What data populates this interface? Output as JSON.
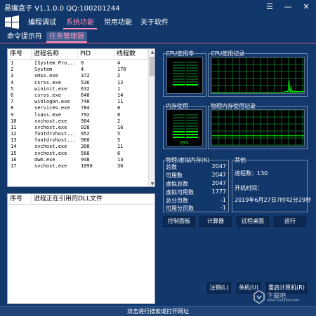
{
  "window": {
    "title": "易编盒子 V1.1.0.0 QQ:100201244",
    "controls": {
      "menu": "☰",
      "minimize": "—",
      "close": "✕"
    }
  },
  "topnav": {
    "items": [
      {
        "label": "编程调试",
        "active": false
      },
      {
        "label": "系统功能",
        "active": true
      },
      {
        "label": "常用功能",
        "active": false
      },
      {
        "label": "关于软件",
        "active": false
      }
    ]
  },
  "subtabs": {
    "items": [
      {
        "label": "命令提示符",
        "active": false
      },
      {
        "label": "任务管理器",
        "active": true
      }
    ]
  },
  "process_table": {
    "columns": [
      "序号",
      "进程名称",
      "PID",
      "线程数"
    ],
    "rows": [
      [
        "1",
        "[System Pro...",
        "0",
        "4"
      ],
      [
        "2",
        "System",
        "4",
        "170"
      ],
      [
        "3",
        "smss.exe",
        "372",
        "2"
      ],
      [
        "4",
        "csrss.exe",
        "536",
        "12"
      ],
      [
        "5",
        "wininit.exe",
        "632",
        "1"
      ],
      [
        "6",
        "csrss.exe",
        "640",
        "14"
      ],
      [
        "7",
        "winlogon.exe",
        "740",
        "11"
      ],
      [
        "8",
        "services.exe",
        "784",
        "8"
      ],
      [
        "9",
        "lsass.exe",
        "792",
        "8"
      ],
      [
        "10",
        "svchost.exe",
        "904",
        "2"
      ],
      [
        "11",
        "svchost.exe",
        "928",
        "16"
      ],
      [
        "12",
        "fontdrvhost...",
        "952",
        "5"
      ],
      [
        "13",
        "fontdrvhost...",
        "960",
        "5"
      ],
      [
        "14",
        "svchost.exe",
        "308",
        "11"
      ],
      [
        "15",
        "svchost.exe",
        "568",
        "6"
      ],
      [
        "16",
        "dwm.exe",
        "948",
        "13"
      ],
      [
        "17",
        "svchost.exe",
        "1096",
        "36"
      ]
    ]
  },
  "dll_table": {
    "columns": [
      "序号",
      "进程正在引用的DLL文件"
    ]
  },
  "monitors": {
    "cpu_usage_label": "CPU使用率",
    "cpu_history_label": "CPU使用记录",
    "mem_usage_label": "内存使用",
    "mem_history_label": "物理内存使用记录",
    "mem_percent_text": "29%",
    "cpu_percent": 0.06,
    "mem_percent": 0.29,
    "cpu_history": [
      0,
      0,
      0,
      0,
      0,
      0,
      0,
      0,
      0,
      0,
      0,
      0,
      0,
      0,
      0,
      0,
      0,
      0,
      0,
      0,
      0,
      0,
      0,
      0,
      0,
      0,
      0,
      0,
      0,
      0,
      0,
      0,
      0,
      0,
      0,
      0,
      0,
      0,
      0,
      0,
      0,
      0,
      0,
      0,
      0,
      0,
      0,
      0,
      0,
      0,
      0,
      0,
      0,
      0,
      0,
      0,
      0,
      0,
      0,
      0,
      0,
      0,
      0,
      0,
      0,
      0,
      0,
      0,
      0,
      0,
      0,
      0,
      0,
      0,
      0,
      0,
      0,
      0,
      0,
      0,
      0,
      0,
      0,
      0,
      0,
      0,
      0,
      0,
      0,
      0,
      0,
      0,
      0,
      0,
      0,
      0,
      0,
      0,
      0,
      0,
      0,
      0,
      0,
      0,
      0,
      0,
      0,
      0,
      0,
      0,
      2,
      3,
      5,
      4,
      6,
      5,
      4,
      12,
      38,
      6,
      3,
      20,
      5,
      3,
      8,
      4,
      6,
      3,
      5,
      6,
      4,
      6,
      3,
      5,
      4,
      6,
      5,
      4,
      6,
      5,
      4,
      5,
      6,
      4
    ],
    "mem_history_flat_percent": 29,
    "grid_color": "#0b6b2a",
    "line_color": "#00ff00"
  },
  "memory_stats": {
    "group_label": "物理/虚拟内存(K)",
    "rows": [
      {
        "label": "总数",
        "value": "2047"
      },
      {
        "label": "可用数",
        "value": "2047"
      },
      {
        "label": "虚拟总数",
        "value": "2047"
      },
      {
        "label": "虚拟可用数",
        "value": "1777"
      },
      {
        "label": "总分页数",
        "value": "-1"
      },
      {
        "label": "可用分页数",
        "value": "-1"
      }
    ]
  },
  "other": {
    "group_label": "其他",
    "process_count": "进程数：130",
    "boot_label": "开机时间：",
    "boot_time": "2019年6月27日7时42分29秒"
  },
  "action_buttons": {
    "control_panel": "控制面板",
    "calculator": "计算器",
    "remote_desktop": "远程桌面",
    "run": "运行"
  },
  "power_buttons": {
    "logoff": "注销(L)",
    "shutdown": "关机(U)",
    "restart": "重启计算机(R)"
  },
  "statusbar": {
    "text": "双击进行搜索或打开网址"
  },
  "watermark": {
    "brand": "下载吧",
    "sub": "www.xiazaiba.com"
  },
  "colors": {
    "background": "#12376a",
    "accent": "#ff8fb8",
    "graph_bg": "#000000",
    "graph_green": "#00ff00"
  }
}
